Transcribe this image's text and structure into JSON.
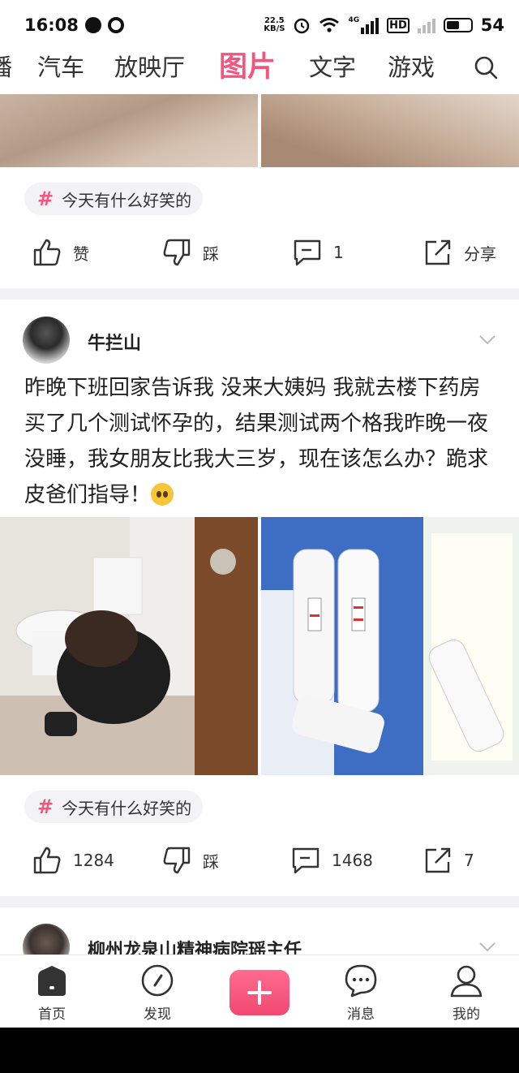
{
  "status_bar": {
    "time": "16:08",
    "net_speed_value": "22.5",
    "net_speed_unit": "KB/S",
    "network": "4G",
    "hd": "HD",
    "battery": "54",
    "battery_level": 0.54
  },
  "tabs": [
    {
      "label": "播"
    },
    {
      "label": "汽车"
    },
    {
      "label": "放映厅"
    },
    {
      "label": "图片",
      "active": true
    },
    {
      "label": "文字"
    },
    {
      "label": "游戏"
    }
  ],
  "post1": {
    "topic": "今天有什么好笑的",
    "like_label": "赞",
    "dislike_label": "踩",
    "comment_count": "1",
    "share_label": "分享"
  },
  "post2": {
    "author": "牛拦山",
    "text": "昨晚下班回家告诉我 没来大姨妈  我就去楼下药房买了几个测试怀孕的，结果测试两个格我昨晚一夜没睡，我女朋友比我大三岁，现在该怎么办？跪求皮爸们指导！",
    "topic": "今天有什么好笑的",
    "like_count": "1284",
    "dislike_label": "踩",
    "comment_count": "1468",
    "share_count": "7"
  },
  "post3": {
    "author": "柳州龙泉山精神病院瑶主任"
  },
  "bottom_nav": {
    "home": "首页",
    "discover": "发现",
    "messages": "消息",
    "mine": "我的"
  },
  "colors": {
    "accent": "#f2567f",
    "divider": "#f2f2f4",
    "chip_bg": "#f3f3f5"
  }
}
